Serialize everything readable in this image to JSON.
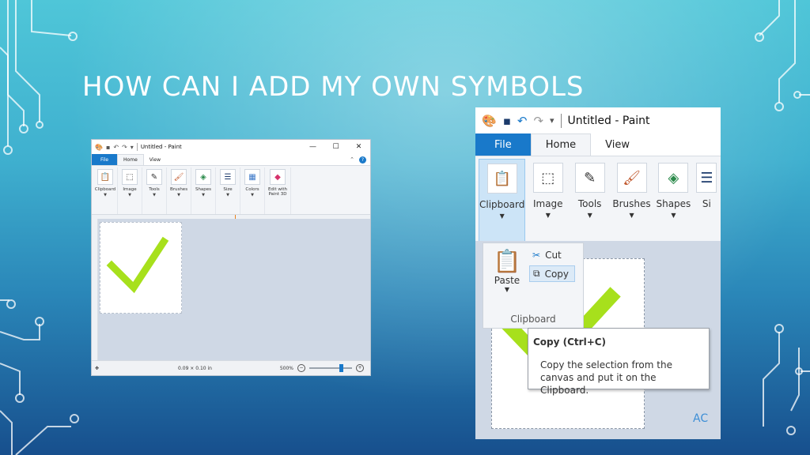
{
  "slide": {
    "title": "HOW CAN I ADD MY OWN SYMBOLS"
  },
  "small_window": {
    "title": "Untitled - Paint",
    "tabs": [
      "File",
      "Home",
      "View"
    ],
    "ribbon_groups": [
      "Clipboard",
      "Image",
      "Tools",
      "Brushes",
      "Shapes",
      "Size",
      "Colors",
      "Edit with Paint 3D"
    ],
    "window_controls": {
      "minimize": "—",
      "maximize": "☐",
      "close": "✕"
    },
    "status": {
      "size": "0.09 × 0.10 in",
      "zoom": "500%"
    }
  },
  "large_window": {
    "title": "Untitled - Paint",
    "tabs": [
      "File",
      "Home",
      "View"
    ],
    "ribbon_groups": [
      "Clipboard",
      "Image",
      "Tools",
      "Brushes",
      "Shapes",
      "Si"
    ],
    "clipboard_menu": {
      "paste_label": "Paste",
      "cut_label": "Cut",
      "copy_label": "Copy",
      "group_label": "Clipboard"
    },
    "tooltip": {
      "title": "Copy (Ctrl+C)",
      "description": "Copy the selection from the canvas and put it on the Clipboard."
    },
    "corner_text": "AC"
  },
  "icons": [
    "paint-app-icon",
    "save-icon",
    "undo-icon",
    "redo-icon",
    "scissors-icon",
    "copy-icon",
    "clipboard-icon",
    "checkmark-drawing"
  ],
  "colors": {
    "accent": "#1979ca",
    "checkmark": "#a7e01c",
    "canvas_bg": "#cfd8e5"
  }
}
